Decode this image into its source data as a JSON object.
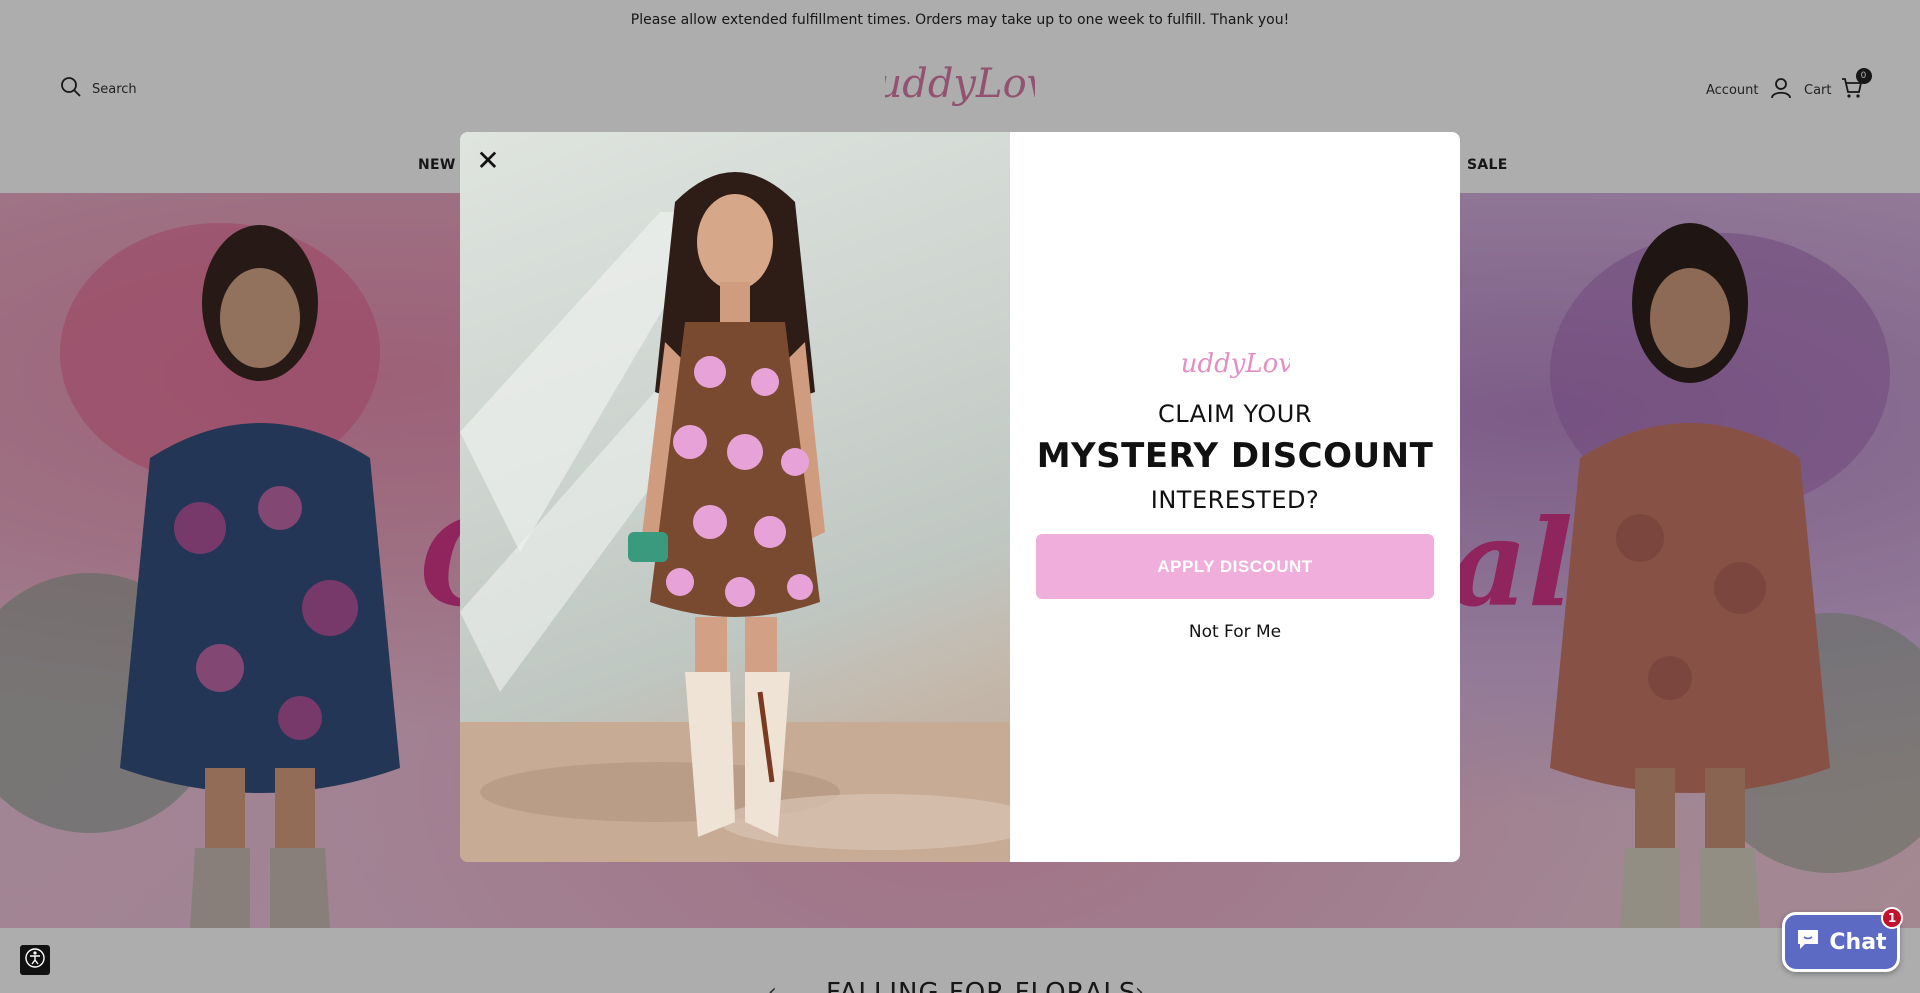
{
  "announcement": "Please allow extended fulfillment times. Orders may take up to one week to fulfill. Thank you!",
  "header": {
    "search_label": "Search",
    "logo_text": "BuddyLove",
    "account_label": "Account",
    "cart_label": "Cart",
    "cart_count": "0"
  },
  "nav": {
    "items": [
      {
        "label": "NEW A"
      },
      {
        "label": "SALE"
      }
    ]
  },
  "hero": {
    "section_title": "FALLING FOR FLORALS",
    "script_left": "C",
    "script_right": "als"
  },
  "modal": {
    "logo_text": "BuddyLove",
    "claim_line": "CLAIM YOUR",
    "headline": "MYSTERY DISCOUNT",
    "question": "INTERESTED?",
    "apply_label": "APPLY DISCOUNT",
    "decline_label": "Not For Me"
  },
  "chat": {
    "label": "Chat",
    "badge": "1"
  },
  "colors": {
    "brand_pink": "#d97aa6",
    "apply_button": "#f0aedc",
    "chat_button": "#5c6ac4",
    "badge_red": "#c2122c"
  }
}
